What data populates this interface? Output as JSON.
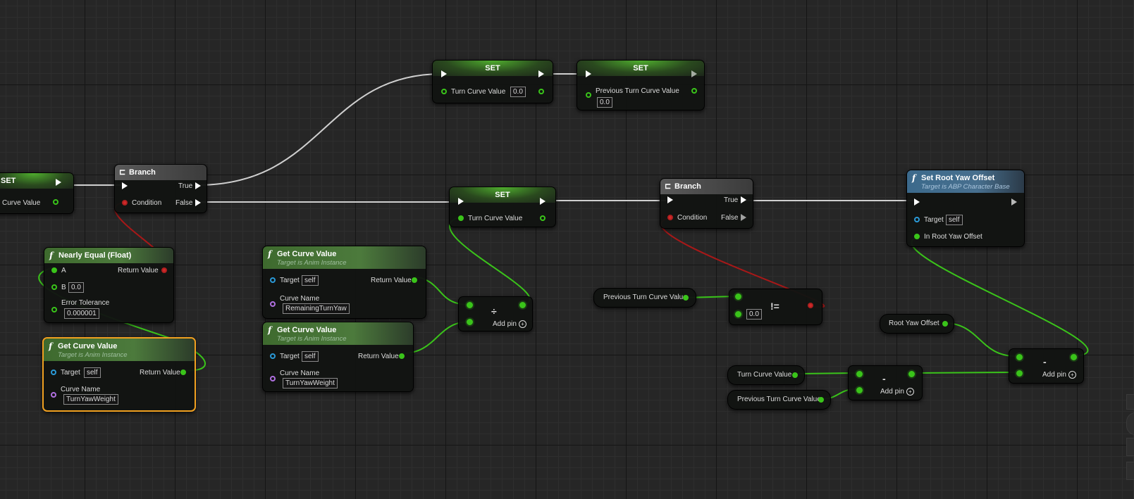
{
  "colors": {
    "float": "#3ac41a",
    "bool": "#b02020",
    "object": "#2a9ad8",
    "name": "#b070e0",
    "exec": "#ffffff",
    "selected": "#f0a020"
  },
  "set_left": {
    "title": "SET",
    "pin": "Curve Value"
  },
  "branch1": {
    "title": "Branch",
    "condition": "Condition",
    "true_label": "True",
    "false_label": "False"
  },
  "branch2": {
    "title": "Branch",
    "condition": "Condition",
    "true_label": "True",
    "false_label": "False"
  },
  "set_turn_top": {
    "title": "SET",
    "pin": "Turn Curve Value",
    "value": "0.0"
  },
  "set_prev_top": {
    "title": "SET",
    "pin": "Previous Turn Curve Value",
    "value": "0.0"
  },
  "set_turn_mid": {
    "title": "SET",
    "pin": "Turn Curve Value"
  },
  "nearly_equal": {
    "title": "Nearly Equal (Float)",
    "a": "A",
    "b": "B",
    "b_value": "0.0",
    "tolerance": "Error Tolerance",
    "tolerance_value": "0.000001",
    "return": "Return Value"
  },
  "get_curve_selected": {
    "title": "Get Curve Value",
    "subtitle": "Target is Anim Instance",
    "target": "Target",
    "target_value": "self",
    "curve_name": "Curve Name",
    "curve_value": "TurnYawWeight",
    "return": "Return Value"
  },
  "get_curve_remaining": {
    "title": "Get Curve Value",
    "subtitle": "Target is Anim Instance",
    "target": "Target",
    "target_value": "self",
    "curve_name": "Curve Name",
    "curve_value": "RemainingTurnYaw",
    "return": "Return Value"
  },
  "get_curve_weight": {
    "title": "Get Curve Value",
    "subtitle": "Target is Anim Instance",
    "target": "Target",
    "target_value": "self",
    "curve_name": "Curve Name",
    "curve_value": "TurnYawWeight",
    "return": "Return Value"
  },
  "divide": {
    "op": "÷",
    "add_pin": "Add pin"
  },
  "prev_turn_getter": {
    "label": "Previous Turn Curve Value"
  },
  "not_equal": {
    "op": "!=",
    "value": "0.0"
  },
  "set_root_yaw": {
    "title": "Set Root Yaw Offset",
    "subtitle": "Target is ABP Character Base",
    "target": "Target",
    "target_value": "self",
    "in_offset": "In Root Yaw Offset"
  },
  "root_yaw_getter": {
    "label": "Root Yaw Offset"
  },
  "turn_getter": {
    "label": "Turn Curve Value"
  },
  "prev_turn_getter2": {
    "label": "Previous Turn Curve Value"
  },
  "subtract1": {
    "op": "-",
    "add_pin": "Add pin"
  },
  "subtract2": {
    "op": "-",
    "add_pin": "Add pin"
  }
}
